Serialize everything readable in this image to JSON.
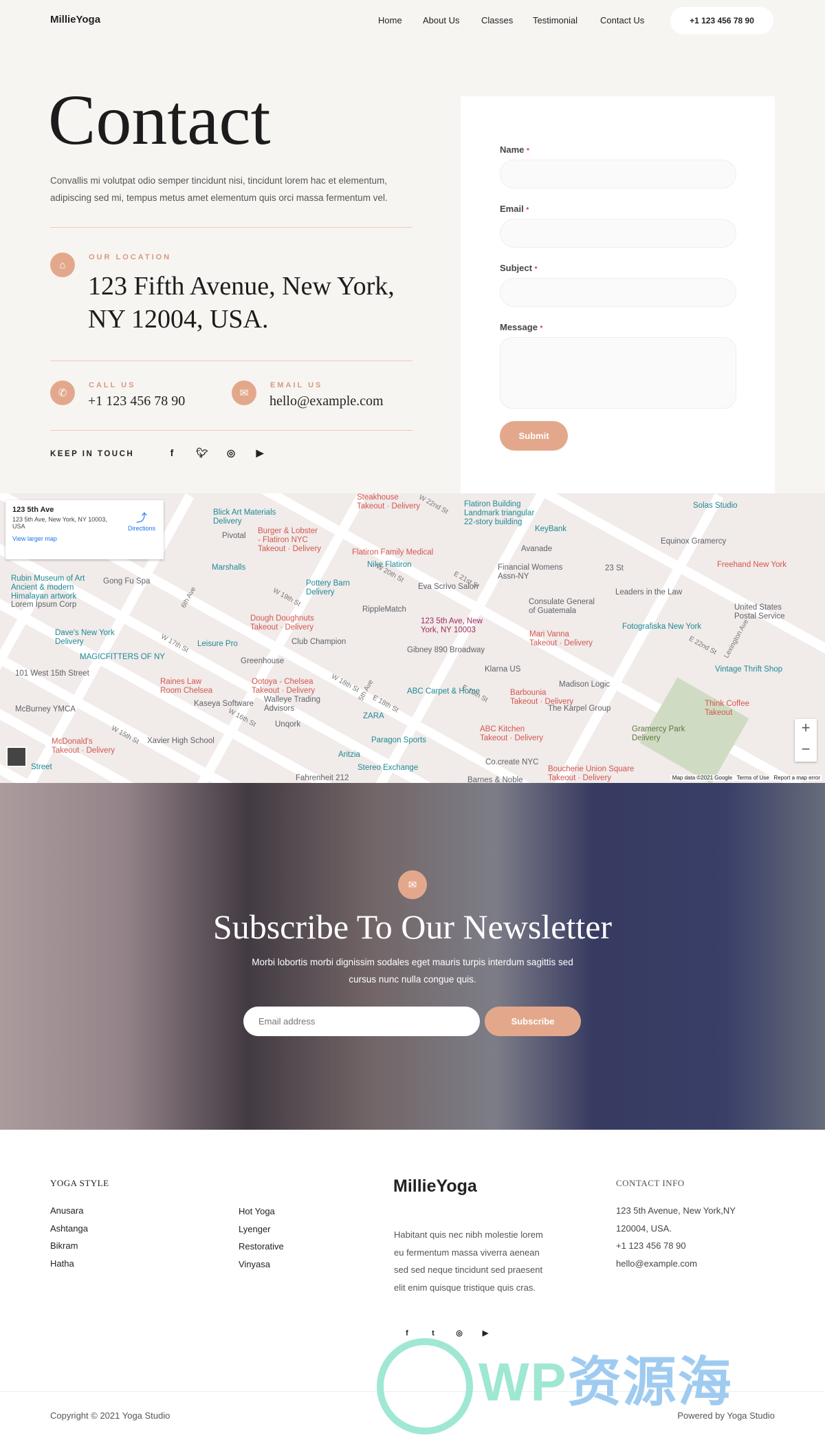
{
  "header": {
    "logo": "MillieYoga",
    "nav": [
      "Home",
      "About Us",
      "Classes",
      "Testimonial",
      "Contact Us"
    ],
    "phone": "+1 123 456 78 90"
  },
  "hero": {
    "title": "Contact",
    "text": "Convallis mi volutpat odio semper tincidunt nisi, tincidunt lorem hac et elementum, adipiscing sed mi, tempus metus amet elementum quis orci massa fermentum vel.",
    "location_label": "OUR LOCATION",
    "location": "123 Fifth Avenue, New York, NY 12004, USA.",
    "call_label": "CALL US",
    "call": "+1 123 456 78 90",
    "email_label": "EMAIL US",
    "email": "hello@example.com",
    "keep_label": "KEEP IN TOUCH",
    "social": [
      "facebook-icon",
      "twitter-icon",
      "instagram-icon",
      "youtube-icon"
    ]
  },
  "form": {
    "name": "Name",
    "email": "Email",
    "subject": "Subject",
    "message": "Message",
    "required": "*",
    "submit": "Submit"
  },
  "map": {
    "info_title": "123 5th Ave",
    "info_address": "123 5th Ave, New York, NY 10003, USA",
    "directions": "Directions",
    "larger": "View larger map",
    "labels": [
      "Blick Art Materials\nDelivery",
      "Pivotal",
      "Burger & Lobster\n- Flatiron NYC\nTakeout · Delivery",
      "Marshalls",
      "Flatiron Family Medical",
      "Nike Flatiron",
      "Pottery Barn\nDelivery",
      "RippleMatch",
      "Rubin Museum of Art\nAncient & modern\nHimalayan artwork",
      "Gong Fu Spa",
      "Lorem Ipsum Corp",
      "Dough Doughnuts\nTakeout · Delivery",
      "Club Champion",
      "Dave's New York\nDelivery",
      "Leisure Pro",
      "MAGICFITTERS OF NY",
      "Greenhouse",
      "101 West 15th Street",
      "Raines Law\nRoom Chelsea",
      "Ootoya - Chelsea\nTakeout · Delivery",
      "Kaseya Software",
      "Walleye Trading\nAdvisors",
      "McBurney YMCA",
      "ZARA",
      "Unqork",
      "McDonald's\nTakeout · Delivery",
      "Xavier High School",
      "Aritzia",
      "Fahrenheit 212",
      "Flatiron Building\nLandmark triangular\n22-story building",
      "KeyBank",
      "Avanade",
      "Eva Scrivo Salon",
      "Financial Womens\nAssn-NY",
      "Consulate General\nof Guatemala",
      "123 5th Ave, New\nYork, NY 10003",
      "Mari Vanna\nTakeout · Delivery",
      "Gibney 890 Broadway",
      "Klarna US",
      "ABC Carpet & Home",
      "Barbounia\nTakeout · Delivery",
      "Madison Logic",
      "The Karpel Group",
      "ABC Kitchen\nTakeout · Delivery",
      "Co.create NYC",
      "Boucherie Union Square\nTakeout · Delivery",
      "23 St",
      "Leaders in the Law",
      "Fotografiska New York",
      "Equinox Gramercy",
      "Solas Studio",
      "Freehand New York",
      "United States\nPostal Service",
      "Vintage Thrift Shop",
      "Think Coffee\nTakeout",
      "Gramercy Park\nDelivery",
      "Paragon Sports",
      "Stereo Exchange",
      "Steakhouse\nTakeout · Delivery",
      "Street",
      "Barnes & Noble"
    ],
    "streets": [
      "W 19th St",
      "W 20th St",
      "6th Ave",
      "W 17th St",
      "W 18th St",
      "5th Ave",
      "E 18th St",
      "W 16th St",
      "W 15th St",
      "E 21st St",
      "E 19th St",
      "E 22nd St",
      "Lexington Ave",
      "W 22nd St"
    ],
    "attribution": [
      "Map data ©2021 Google",
      "Terms of Use",
      "Report a map error"
    ],
    "zoom_in": "+",
    "zoom_out": "−"
  },
  "newsletter": {
    "title": "Subscribe To Our Newsletter",
    "text": "Morbi lobortis morbi dignissim sodales eget mauris turpis interdum sagittis sed cursus nunc nulla congue quis.",
    "placeholder": "Email address",
    "button": "Subscribe"
  },
  "footer": {
    "yoga_title": "YOGA STYLE",
    "col1": [
      "Anusara",
      "Ashtanga",
      "Bikram",
      "Hatha"
    ],
    "col2": [
      "Hot Yoga",
      "Lyenger",
      "Restorative",
      "Vinyasa"
    ],
    "logo": "MillieYoga",
    "about": "Habitant quis nec nibh molestie lorem eu fermentum massa viverra aenean sed sed neque tincidunt sed praesent elit enim quisque tristique quis cras.",
    "contact_title": "CONTACT INFO",
    "contact": [
      "123 5th Avenue, New York,NY",
      "120004, USA.",
      "+1 123 456 78 90",
      "hello@example.com"
    ],
    "copyright": "Copyright © 2021 Yoga Studio",
    "powered": "Powered by Yoga Studio",
    "watermark": "WP资源海"
  },
  "colors": {
    "accent": "#e3a88c",
    "background": "#f7f5f2"
  }
}
